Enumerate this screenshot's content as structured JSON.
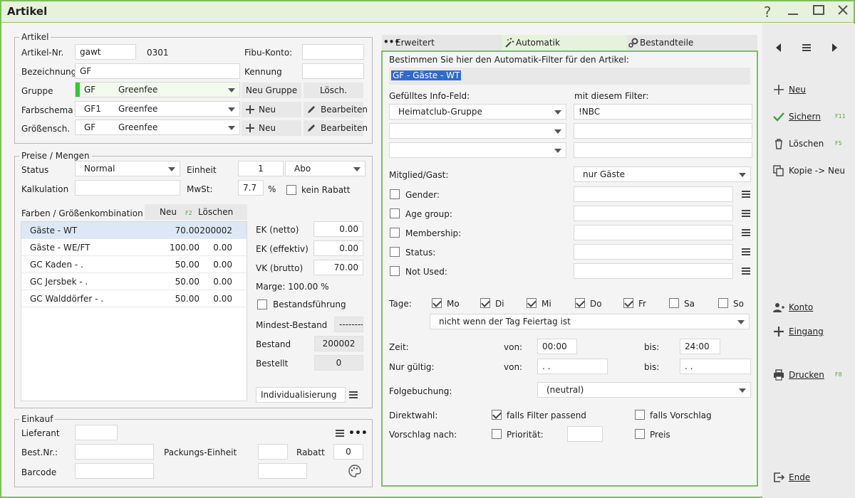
{
  "window": {
    "title": "Artikel"
  },
  "artikel": {
    "legend": "Artikel",
    "nr_label": "Artikel-Nr.",
    "nr_value": "gawt",
    "nr_code": "0301",
    "fibu_label": "Fibu-Konto:",
    "fibu_value": "",
    "bez_label": "Bezeichnung",
    "bez_value": "GF",
    "kennung_label": "Kennung",
    "kennung_value": "",
    "gruppe_label": "Gruppe",
    "gruppe_code": "GF",
    "gruppe_name": "Greenfee",
    "neu_gruppe": "Neu Gruppe",
    "losch": "Lösch.",
    "farb_label": "Farbschema",
    "farb_code": "GF1",
    "farb_name": "Greenfee",
    "neu": "Neu",
    "bearbeiten": "Bearbeiten",
    "groesse_label": "Größensch.",
    "groesse_code": "GF",
    "groesse_name": "Greenfee"
  },
  "preise": {
    "legend": "Preise / Mengen",
    "status_label": "Status",
    "status_value": "Normal",
    "einheit_label": "Einheit",
    "einheit_value": "1",
    "einheit_type": "Abo",
    "kalk_label": "Kalkulation",
    "kalk_value": "",
    "mwst_label": "MwSt:",
    "mwst_value": "7.7",
    "percent": "%",
    "kein_rabatt": "kein Rabatt",
    "kombi_label": "Farben / Größenkombination",
    "kombi_neu": "Neu",
    "kombi_neu_key": "F2",
    "kombi_loschen": "Löschen",
    "rows": [
      {
        "name": "Gäste - WT",
        "price": "70.00",
        "val": "200002"
      },
      {
        "name": "Gäste - WE/FT",
        "price": "100.00",
        "val": "0.00"
      },
      {
        "name": "GC Kaden - .",
        "price": "50.00",
        "val": "0.00"
      },
      {
        "name": "GC Jersbek - .",
        "price": "50.00",
        "val": "0.00"
      },
      {
        "name": "GC Walddörfer - .",
        "price": "50.00",
        "val": "0.00"
      }
    ],
    "ek_netto_label": "EK (netto)",
    "ek_netto": "0.00",
    "ek_eff_label": "EK (effektiv)",
    "ek_eff": "0.00",
    "vk_label": "VK (brutto)",
    "vk": "70.00",
    "marge": "Marge: 100.00 %",
    "bestandsf": "Bestandsführung",
    "mindest_label": "Mindest-Bestand",
    "mindest": "--------",
    "bestand_label": "Bestand",
    "bestand": "200002",
    "bestellt_label": "Bestellt",
    "bestellt": "0",
    "indiv": "Individualisierung"
  },
  "einkauf": {
    "legend": "Einkauf",
    "lieferant_label": "Lieferant",
    "lieferant": "",
    "bestnr_label": "Best.Nr.:",
    "bestnr": "",
    "packung_label": "Packungs-Einheit",
    "packung": "",
    "rabatt_label": "Rabatt",
    "rabatt": "0",
    "barcode_label": "Barcode",
    "barcode": "",
    "barcode2": ""
  },
  "tabs": {
    "erweitert": "Erweitert",
    "automatik": "Automatik",
    "bestandteile": "Bestandteile"
  },
  "auto": {
    "intro": "Bestimmen Sie hier den Automatik-Filter für den Artikel:",
    "filter": "GF - Gäste - WT",
    "info_label": "Gefülltes Info-Feld:",
    "filter_label": "mit diesem Filter:",
    "info1": "Heimatclub-Gruppe",
    "filter1": "!NBC",
    "mitglied_label": "Mitglied/Gast:",
    "mitglied_value": "nur Gäste",
    "criteria": [
      {
        "label": "Gender:",
        "value": ""
      },
      {
        "label": "Age group:",
        "value": ""
      },
      {
        "label": "Membership:",
        "value": ""
      },
      {
        "label": "Status:",
        "value": ""
      },
      {
        "label": "Not Used:",
        "value": ""
      }
    ],
    "tage_label": "Tage:",
    "days": [
      {
        "label": "Mo",
        "checked": true
      },
      {
        "label": "Di",
        "checked": true
      },
      {
        "label": "Mi",
        "checked": true
      },
      {
        "label": "Do",
        "checked": true
      },
      {
        "label": "Fr",
        "checked": true
      },
      {
        "label": "Sa",
        "checked": false
      },
      {
        "label": "So",
        "checked": false
      }
    ],
    "feiertag": "nicht wenn der Tag Feiertag ist",
    "zeit_label": "Zeit:",
    "von": "von:",
    "bis": "bis:",
    "zeit_von": "00:00",
    "zeit_bis": "24:00",
    "gueltig_label": "Nur gültig:",
    "gueltig_von": " .  .",
    "gueltig_bis": " .  .",
    "folge_label": "Folgebuchung:",
    "folge_value": "(neutral)",
    "direkt_label": "Direktwahl:",
    "falls_filter": "falls Filter passend",
    "falls_vorschlag": "falls Vorschlag",
    "vorschlag_label": "Vorschlag nach:",
    "prioritaet": "Priorität:",
    "prioritaet_value": "",
    "preis": "Preis"
  },
  "sidebar": {
    "neu": "Neu",
    "sichern": "Sichern",
    "sichern_key": "F11",
    "loeschen": "Löschen",
    "loeschen_key": "F5",
    "kopie": "Kopie -> Neu",
    "konto": "Konto",
    "eingang": "Eingang",
    "drucken": "Drucken",
    "drucken_key": "F8",
    "ende": "Ende"
  }
}
